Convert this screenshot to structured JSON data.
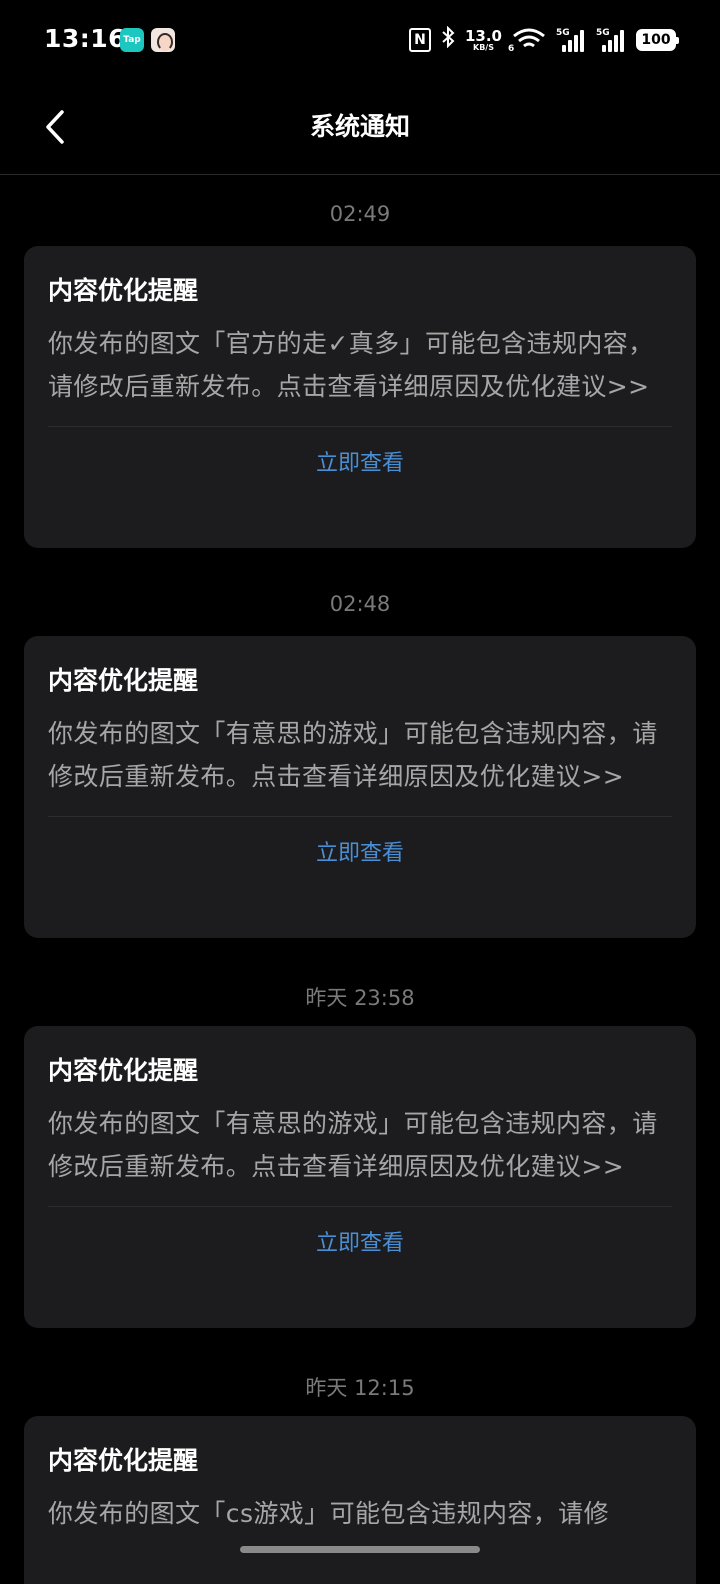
{
  "status_bar": {
    "time": "13:16",
    "app_icon_1_label": "Tap",
    "nfc_label": "N",
    "net_speed_value": "13.0",
    "net_speed_unit": "KB/S",
    "signal_1_label": "5G",
    "signal_2_label": "5G",
    "wifi_sub_label": "6",
    "battery_level": "100"
  },
  "navbar": {
    "back_icon": "chevron-left-icon",
    "title": "系统通知"
  },
  "notifications": [
    {
      "time": "02:49",
      "title": "内容优化提醒",
      "body": "你发布的图文「官方的走✓真多」可能包含违规内容，请修改后重新发布。点击查看详细原因及优化建议>>",
      "action": "立即查看"
    },
    {
      "time": "02:48",
      "title": "内容优化提醒",
      "body": "你发布的图文「有意思的游戏」可能包含违规内容，请修改后重新发布。点击查看详细原因及优化建议>>",
      "action": "立即查看"
    },
    {
      "time": "昨天  23:58",
      "title": "内容优化提醒",
      "body": "你发布的图文「有意思的游戏」可能包含违规内容，请修改后重新发布。点击查看详细原因及优化建议>>",
      "action": "立即查看"
    },
    {
      "time": "昨天  12:15",
      "title": "内容优化提醒",
      "body": "你发布的图文「cs游戏」可能包含违规内容，请修",
      "action": ""
    }
  ],
  "colors": {
    "background": "#000000",
    "card": "#1c1c1e",
    "action_link": "#4a8fd6",
    "timestamp": "#7a7a7a"
  }
}
